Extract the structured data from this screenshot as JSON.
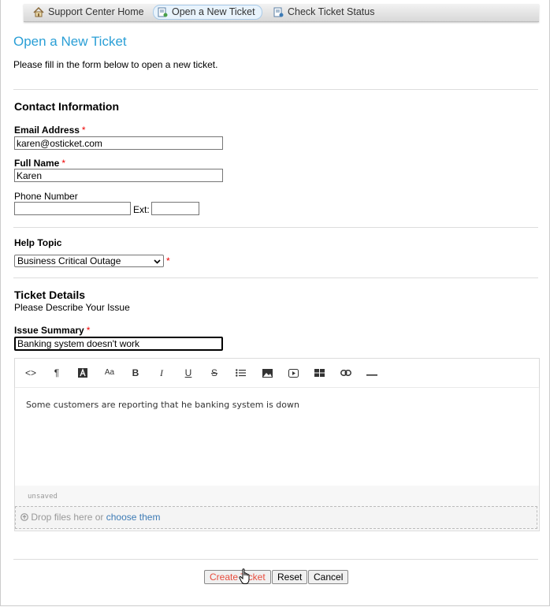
{
  "nav": {
    "items": [
      {
        "label": "Support Center Home",
        "icon": "home-icon"
      },
      {
        "label": "Open a New Ticket",
        "icon": "new-ticket-icon"
      },
      {
        "label": "Check Ticket Status",
        "icon": "ticket-status-icon"
      }
    ],
    "active_index": 1
  },
  "page": {
    "title": "Open a New Ticket",
    "intro": "Please fill in the form below to open a new ticket."
  },
  "contact": {
    "title": "Contact Information",
    "email_label": "Email Address",
    "email_value": "karen@osticket.com",
    "name_label": "Full Name",
    "name_value": "Karen",
    "phone_label": "Phone Number",
    "phone_value": "",
    "ext_label": "Ext:",
    "ext_value": "",
    "required_mark": "*"
  },
  "help": {
    "title": "Help Topic",
    "selected": "Business Critical Outage"
  },
  "details": {
    "title": "Ticket Details",
    "subtitle": "Please Describe Your Issue",
    "summary_label": "Issue Summary",
    "summary_value": "Banking system doesn't work",
    "body_text": "Some customers are reporting that he banking system is down",
    "status": "unsaved",
    "drop_text": "Drop files here or",
    "drop_link": "choose them"
  },
  "buttons": {
    "create": "Create Ticket",
    "reset": "Reset",
    "cancel": "Cancel"
  },
  "colors": {
    "title": "#2a9fd6",
    "required": "#e00000",
    "create_text": "#e84c3d",
    "link": "#3d7bb5"
  }
}
